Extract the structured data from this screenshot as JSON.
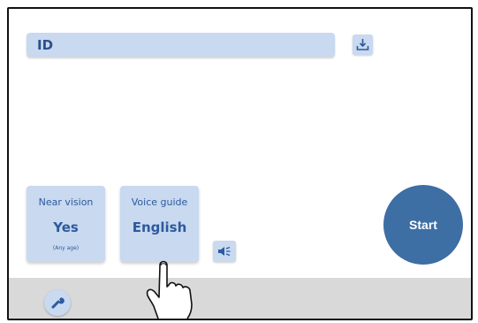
{
  "id_field": {
    "label": "ID",
    "download_icon": "download-icon"
  },
  "tiles": {
    "near_vision": {
      "title": "Near vision",
      "value": "Yes",
      "note": "(Any age)"
    },
    "voice_guide": {
      "title": "Voice guide",
      "value": "English"
    }
  },
  "speaker_icon": "speaker-icon",
  "start": {
    "label": "Start"
  },
  "footer": {
    "wrench_icon": "wrench-icon"
  },
  "pointer_icon": "hand-pointer-icon",
  "colors": {
    "tile_bg": "#c8d9f0",
    "tile_text": "#2d5a9c",
    "start_bg": "#3d6ea4",
    "footer_bg": "#d9d9d9"
  }
}
